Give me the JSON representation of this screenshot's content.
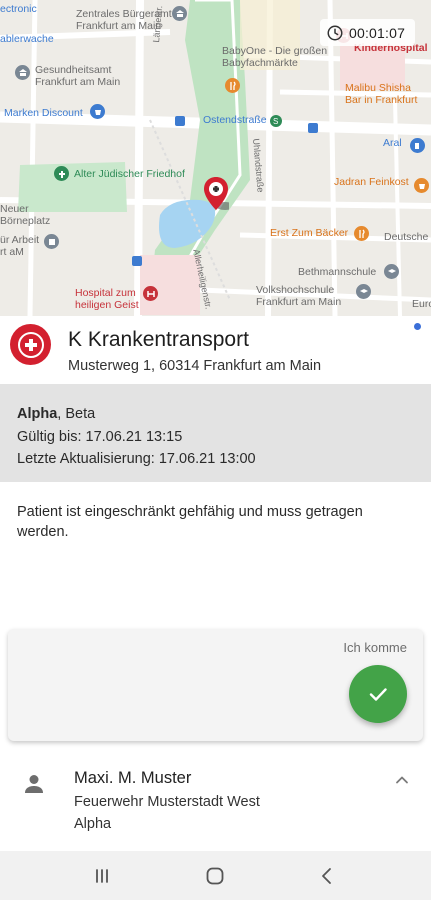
{
  "map": {
    "labels": [
      {
        "text": "ectronic",
        "cls": "blue"
      },
      {
        "text": "Zentrales Bürgeramt\nFrankfurt am Main",
        "cls": "gray"
      },
      {
        "text": "BabyOne - Die großen\nBabyfachmärkte",
        "cls": "gray"
      },
      {
        "text": "Kinderhospital",
        "cls": "red"
      },
      {
        "text": "ablerwache",
        "cls": "blue"
      },
      {
        "text": "Gesundheitsamt\nFrankfurt am Main",
        "cls": "gray"
      },
      {
        "text": "Malibu Shisha\nBar in Frankfurt",
        "cls": "orange"
      },
      {
        "text": "Marken Discount",
        "cls": "blue"
      },
      {
        "text": "Ostendstraße",
        "cls": "blue"
      },
      {
        "text": "Aral",
        "cls": "blue"
      },
      {
        "text": "Alter Jüdischer Friedhof",
        "cls": "green"
      },
      {
        "text": "Jadran Feinkost",
        "cls": "orange"
      },
      {
        "text": "Neuer\nBörneplatz",
        "cls": "gray"
      },
      {
        "text": "ür Arbeit\nrt aM",
        "cls": "gray"
      },
      {
        "text": "Erst Zum Bäcker",
        "cls": "orange"
      },
      {
        "text": "Deutsche",
        "cls": "gray"
      },
      {
        "text": "Bethmannschule",
        "cls": "gray"
      },
      {
        "text": "Volkshochschule\nFrankfurt am Main",
        "cls": "gray"
      },
      {
        "text": "Hospital zum\nheiligen Geist",
        "cls": "red"
      },
      {
        "text": "Euro",
        "cls": "gray"
      },
      {
        "text": "Längestr.",
        "cls": "gray"
      },
      {
        "text": "Uhlandstraße",
        "cls": "gray"
      },
      {
        "text": "Allerheiligenstr.",
        "cls": "gray"
      }
    ]
  },
  "timer": {
    "icon": "clock-icon",
    "value": "00:01:07"
  },
  "destination": {
    "icon": "ambulance-cross-icon",
    "title": "K Krankentransport",
    "address": "Musterweg 1, 60314 Frankfurt am Main"
  },
  "info": {
    "patient_last": "Alpha",
    "patient_first": ", Beta",
    "valid_until": "Gültig bis: 17.06.21 13:15",
    "last_update": "Letzte Aktualisierung: 17.06.21 13:00"
  },
  "note": "Patient ist eingeschränkt gehfähig und muss getragen werden.",
  "response": {
    "label": "Ich komme",
    "button_icon": "check-icon"
  },
  "responder": {
    "icon": "person-icon",
    "name": "Maxi. M. Muster",
    "organization": "Feuerwehr Musterstadt West",
    "unit": "Alpha",
    "toggle_icon": "chevron-up-icon"
  },
  "navbar": {
    "recents_icon": "recents-icon",
    "home_icon": "home-icon",
    "back_icon": "back-icon"
  },
  "colors": {
    "accent_red": "#d3202f",
    "fab_green": "#43a348",
    "info_bg": "#e3e3e3",
    "indicator_blue": "#3b6fd8"
  }
}
